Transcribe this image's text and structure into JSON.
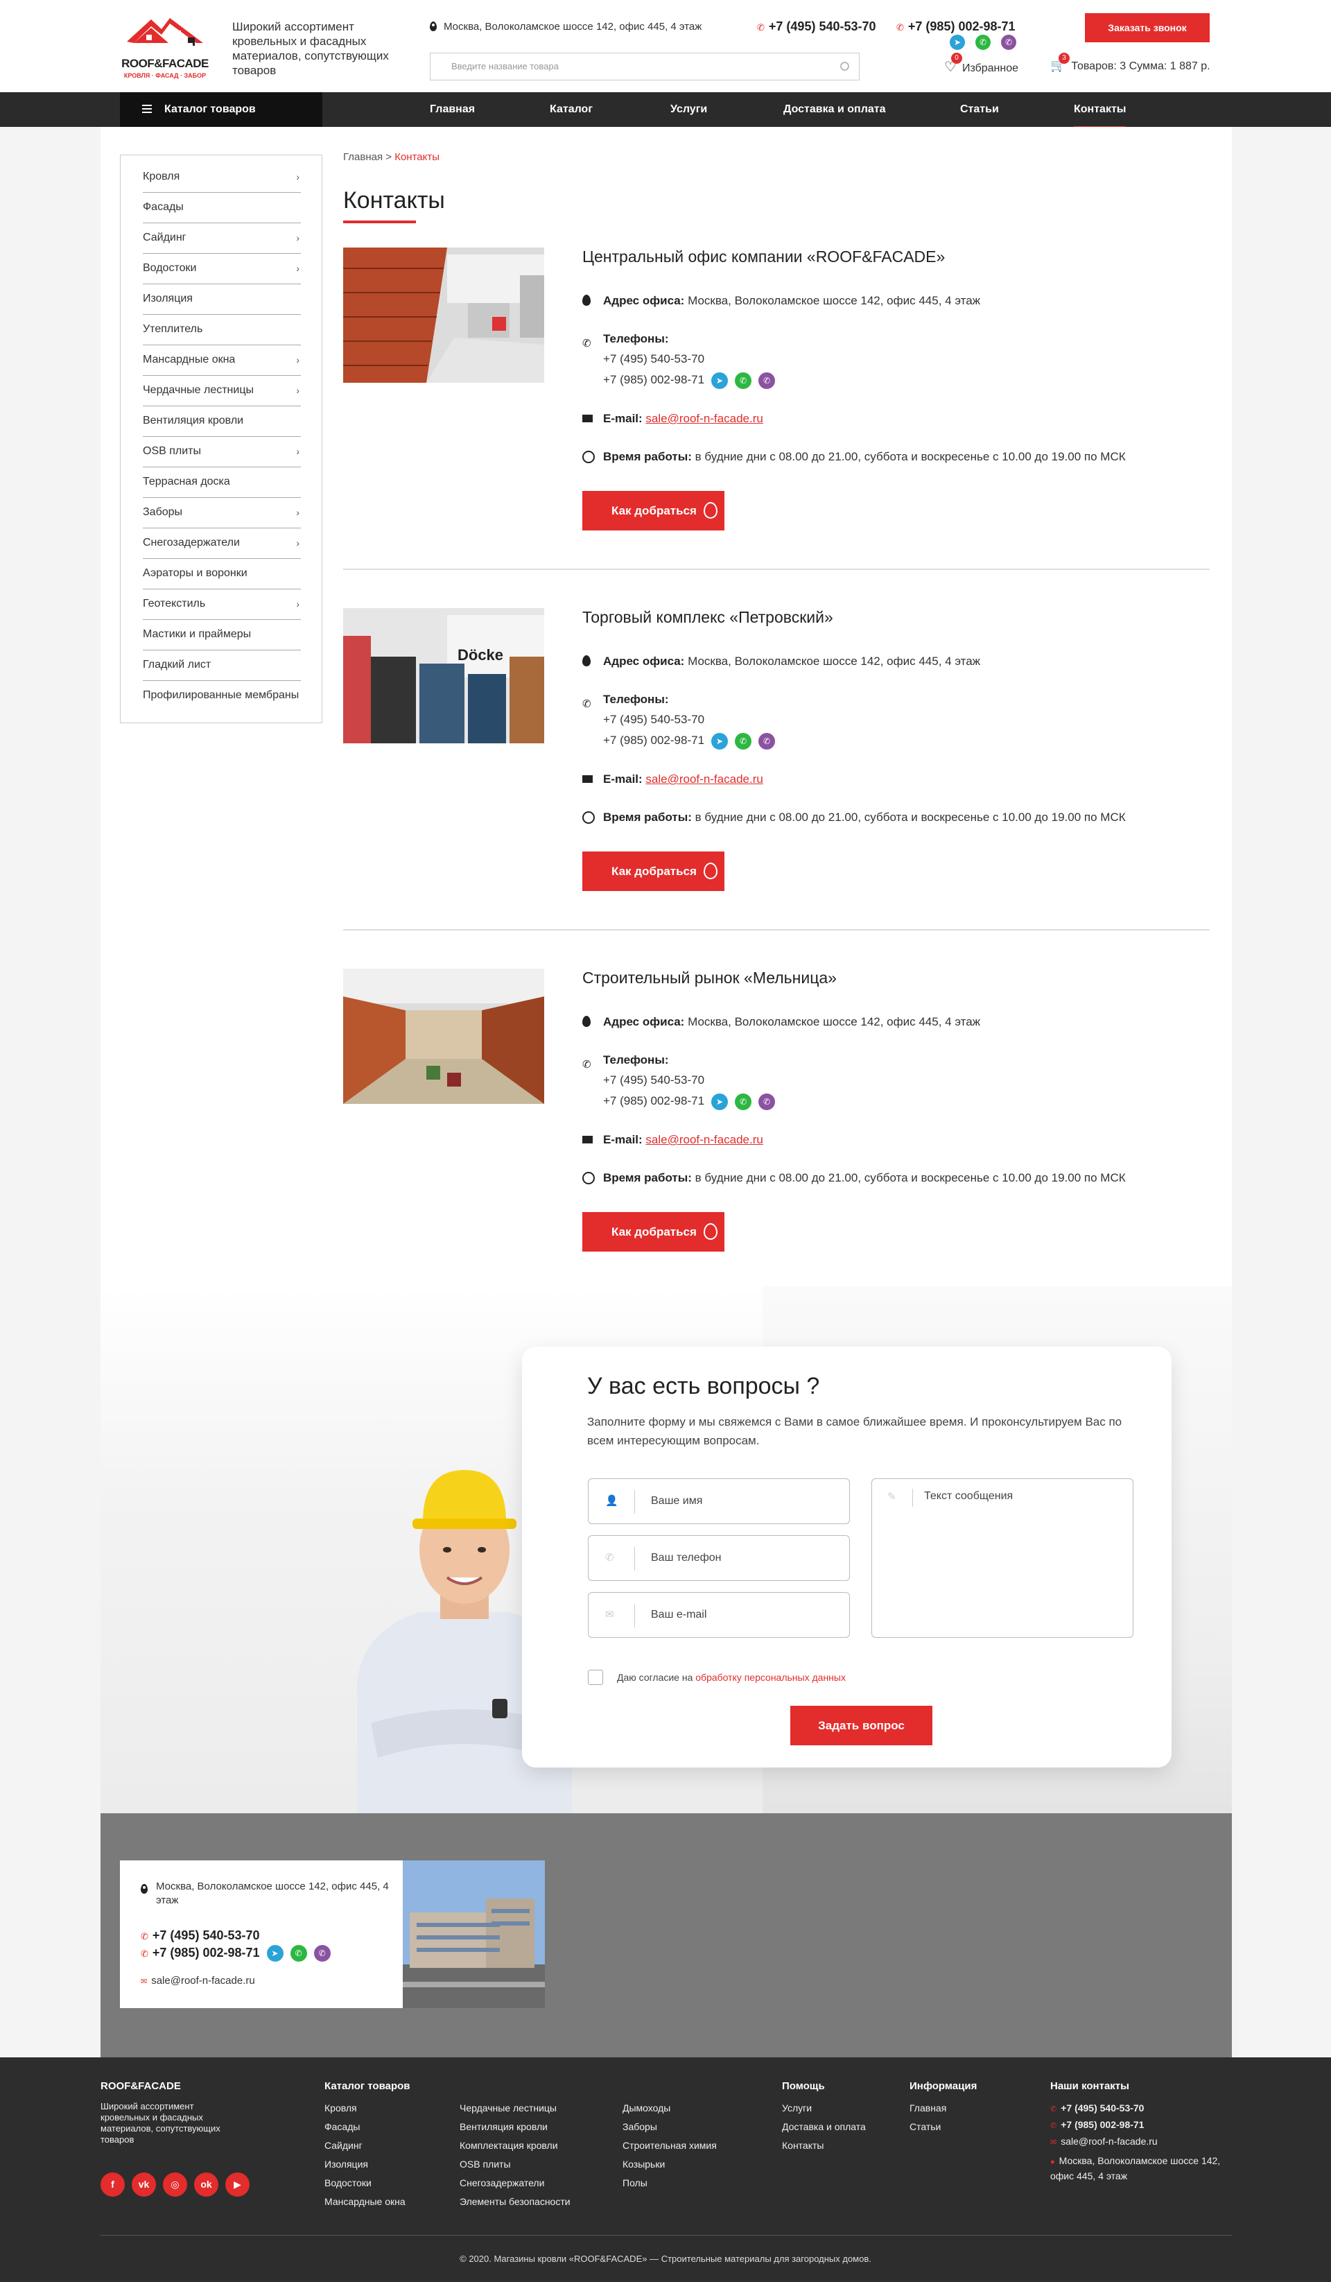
{
  "header": {
    "logo_brand": "ROOF&FACADE",
    "logo_sub": "КРОВЛЯ · ФАСАД · ЗАБОР",
    "tagline": "Широкий ассортимент кровельных и фасадных материалов, сопутствующих товаров",
    "address": "Москва, Волоколамское шоссе 142, офис 445, 4 этаж",
    "phone1": "+7 (495) 540-53-70",
    "phone2": "+7 (985) 002-98-71",
    "search_placeholder": "Введите название товара",
    "call_button": "Заказать звонок",
    "favorites_label": "Избранное",
    "favorites_count": "0",
    "cart_label": "Товаров: 3 Сумма: 1 887 р.",
    "cart_count": "3"
  },
  "nav": {
    "catalog": "Каталог товаров",
    "items": [
      "Главная",
      "Каталог",
      "Услуги",
      "Доставка и оплата",
      "Статьи",
      "Контакты"
    ]
  },
  "sidebar": {
    "items": [
      {
        "label": "Кровля",
        "arrow": "›"
      },
      {
        "label": "Фасады",
        "arrow": ""
      },
      {
        "label": "Сайдинг",
        "arrow": "›"
      },
      {
        "label": "Водостоки",
        "arrow": "›"
      },
      {
        "label": "Изоляция",
        "arrow": ""
      },
      {
        "label": "Утеплитель",
        "arrow": ""
      },
      {
        "label": "Мансардные окна",
        "arrow": "›"
      },
      {
        "label": "Чердачные лестницы",
        "arrow": "›"
      },
      {
        "label": "Вентиляция кровли",
        "arrow": ""
      },
      {
        "label": "OSB плиты",
        "arrow": "›"
      },
      {
        "label": "Террасная доска",
        "arrow": ""
      },
      {
        "label": "Заборы",
        "arrow": "›"
      },
      {
        "label": "Снегозадержатели",
        "arrow": "›"
      },
      {
        "label": "Аэраторы и воронки",
        "arrow": ""
      },
      {
        "label": "Геотекстиль",
        "arrow": "›"
      },
      {
        "label": "Мастики и праймеры",
        "arrow": ""
      },
      {
        "label": "Гладкий лист",
        "arrow": ""
      },
      {
        "label": "Профилированные мембраны",
        "arrow": ""
      }
    ]
  },
  "breadcrumb": {
    "home": "Главная",
    "sep": ">",
    "current": "Контакты"
  },
  "page_title": "Контакты",
  "offices": [
    {
      "title": "Центральный офис компании «ROOF&FACADE»",
      "address_label": "Адрес офиса:",
      "address": "Москва, Волоколамское шоссе 142, офис 445, 4 этаж",
      "phones_label": "Телефоны:",
      "phone1": "+7 (495) 540-53-70",
      "phone2": "+7 (985) 002-98-71",
      "email_label": "E-mail:",
      "email": "sale@roof-n-facade.ru",
      "hours_label": "Время работы:",
      "hours": "в будние дни с 08.00 до 21.00, суббота и воскресенье с 10.00 до 19.00 по МСК",
      "route_button": "Как добраться"
    },
    {
      "title": "Торговый комплекс «Петровский»",
      "address_label": "Адрес офиса:",
      "address": "Москва, Волоколамское шоссе 142, офис 445, 4 этаж",
      "phones_label": "Телефоны:",
      "phone1": "+7 (495) 540-53-70",
      "phone2": "+7 (985) 002-98-71",
      "email_label": "E-mail:",
      "email": "sale@roof-n-facade.ru",
      "hours_label": "Время работы:",
      "hours": "в будние дни с 08.00 до 21.00, суббота и воскресенье с 10.00 до 19.00 по МСК",
      "route_button": "Как добраться"
    },
    {
      "title": "Строительный рынок «Мельница»",
      "address_label": "Адрес офиса:",
      "address": "Москва, Волоколамское шоссе 142, офис 445, 4 этаж",
      "phones_label": "Телефоны:",
      "phone1": "+7 (495) 540-53-70",
      "phone2": "+7 (985) 002-98-71",
      "email_label": "E-mail:",
      "email": "sale@roof-n-facade.ru",
      "hours_label": "Время работы:",
      "hours": "в будние дни с 08.00 до 21.00, суббота и воскресенье с 10.00 до 19.00 по МСК",
      "route_button": "Как добраться"
    }
  ],
  "photo_sign": "Döcke",
  "question": {
    "title": "У вас есть вопросы ?",
    "subtitle": "Заполните форму и мы свяжемся с Вами в самое ближайшее время. И проконсультируем Вас по всем интересующим вопросам.",
    "name_placeholder": "Ваше имя",
    "phone_placeholder": "Ваш телефон",
    "email_placeholder": "Ваш e-mail",
    "message_placeholder": "Текст сообщения",
    "consent_text": "Даю согласие на",
    "consent_link": "обработку персональных данных",
    "submit": "Задать вопрос"
  },
  "map_card": {
    "address": "Москва, Волоколамское шоссе 142, офис 445, 4 этаж",
    "phone1": "+7 (495) 540-53-70",
    "phone2": "+7 (985) 002-98-71",
    "email": "sale@roof-n-facade.ru"
  },
  "footer": {
    "brand": "ROOF&FACADE",
    "tagline": "Широкий ассортимент кровельных и фасадных материалов, сопутствующих товаров",
    "catalog_title": "Каталог товаров",
    "catalog_col1": [
      "Кровля",
      "Фасады",
      "Сайдинг",
      "Изоляция",
      "Водостоки",
      "Мансардные окна"
    ],
    "catalog_col2": [
      "Чердачные лестницы",
      "Вентиляция кровли",
      "Комплектация кровли",
      "OSB плиты",
      "Снегозадержатели",
      "Элементы безопасности"
    ],
    "catalog_col3": [
      "Дымоходы",
      "Заборы",
      "Строительная химия",
      "Козырьки",
      "Полы"
    ],
    "help_title": "Помощь",
    "help_items": [
      "Услуги",
      "Доставка и оплата",
      "Контакты"
    ],
    "info_title": "Информация",
    "info_items": [
      "Главная",
      "Статьи"
    ],
    "contacts_title": "Наши контакты",
    "phone1": "+7 (495) 540-53-70",
    "phone2": "+7 (985) 002-98-71",
    "email": "sale@roof-n-facade.ru",
    "address": "Москва, Волоколамское шоссе 142, офис 445, 4 этаж",
    "social": [
      "f",
      "vk",
      "ig",
      "ok",
      "yt"
    ],
    "copyright": "© 2020. Магазины кровли «ROOF&FACADE» — Строительные материалы для загородных домов."
  },
  "colors": {
    "accent": "#e32c2c",
    "dark": "#2b2b2b",
    "telegram": "#2aa3d8",
    "whatsapp": "#2db742",
    "viber": "#8b52a1"
  }
}
